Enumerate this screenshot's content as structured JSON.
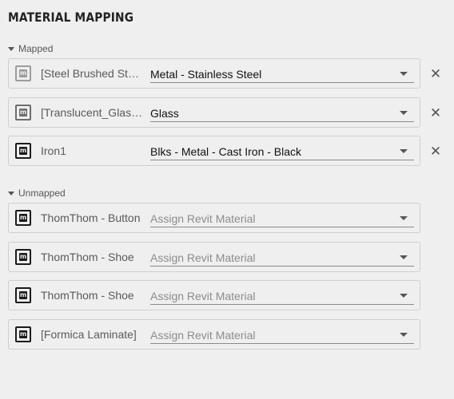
{
  "title": "MATERIAL MAPPING",
  "mapped": {
    "label": "Mapped",
    "items": [
      {
        "name": "[Steel Brushed Stainless]",
        "value": "Metal - Stainless Steel",
        "icon": "material-icon"
      },
      {
        "name": "[Translucent_Glass_Gray]",
        "value": "Glass",
        "icon": "material-icon"
      },
      {
        "name": "Iron1",
        "value": "Blks - Metal - Cast Iron - Black",
        "icon": "material-icon"
      }
    ],
    "remove_glyph": "✕"
  },
  "unmapped": {
    "label": "Unmapped",
    "placeholder": "Assign Revit Material",
    "items": [
      {
        "name": "ThomThom - Button",
        "icon": "material-icon"
      },
      {
        "name": "ThomThom - Shoe",
        "icon": "material-icon"
      },
      {
        "name": "ThomThom - Shoe",
        "icon": "material-icon"
      },
      {
        "name": "[Formica Laminate]",
        "icon": "material-icon"
      }
    ]
  }
}
